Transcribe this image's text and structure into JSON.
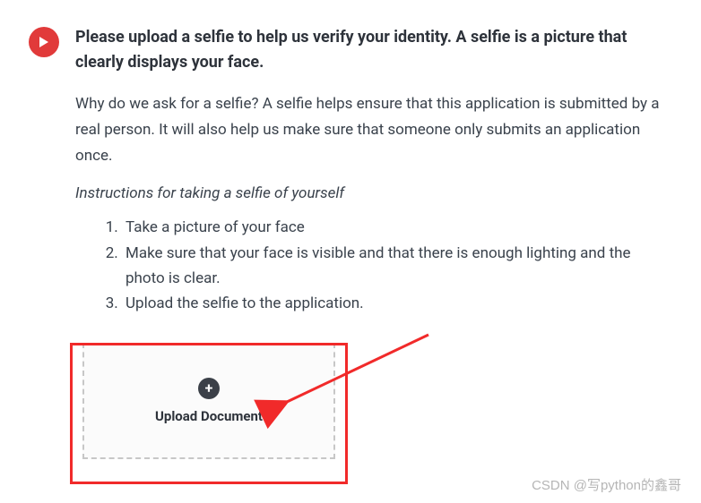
{
  "heading": "Please upload a selfie to help us verify your identity. A selfie is a picture that clearly displays your face.",
  "body": "Why do we ask for a selfie? A selfie helps ensure that this application is submitted by a real person. It will also help us make sure that someone only submits an application once.",
  "instructions_label": "Instructions for taking a selfie of yourself",
  "steps": [
    "Take a picture of your face",
    "Make sure that your face is visible and that there is enough lighting and the photo is clear.",
    "Upload the selfie to the application."
  ],
  "upload": {
    "label": "Upload Document"
  },
  "watermark": "CSDN @写python的鑫哥",
  "colors": {
    "accent_red": "#e13a3a",
    "highlight_box": "#f12a2a"
  }
}
